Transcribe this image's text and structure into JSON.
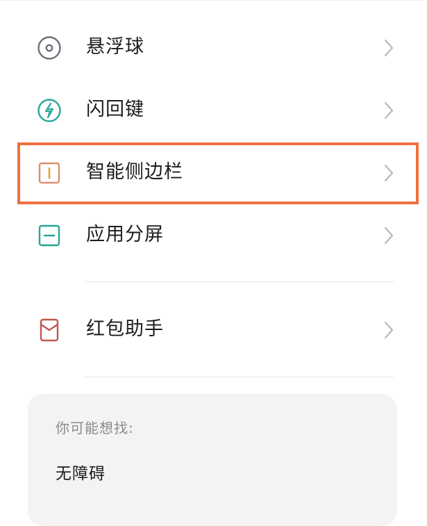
{
  "settings_list": {
    "items": [
      {
        "label": "悬浮球",
        "icon": "floating-ball-icon",
        "color": "#6a7079"
      },
      {
        "label": "闪回键",
        "icon": "flashback-icon",
        "color": "#2aa59a"
      },
      {
        "label": "智能侧边栏",
        "icon": "smart-sidebar-icon",
        "color": "#d9906a",
        "accent": "#e2a23a",
        "highlighted": true
      },
      {
        "label": "应用分屏",
        "icon": "split-screen-icon",
        "color": "#26a596"
      },
      {
        "label": "红包助手",
        "icon": "red-envelope-icon",
        "color": "#c0564f"
      }
    ]
  },
  "suggestions": {
    "title": "你可能想找:",
    "items": [
      "无障碍"
    ]
  },
  "colors": {
    "highlight_border": "#ee7040",
    "chevron": "#b8b8b8",
    "card_bg": "#f3f3f3"
  }
}
